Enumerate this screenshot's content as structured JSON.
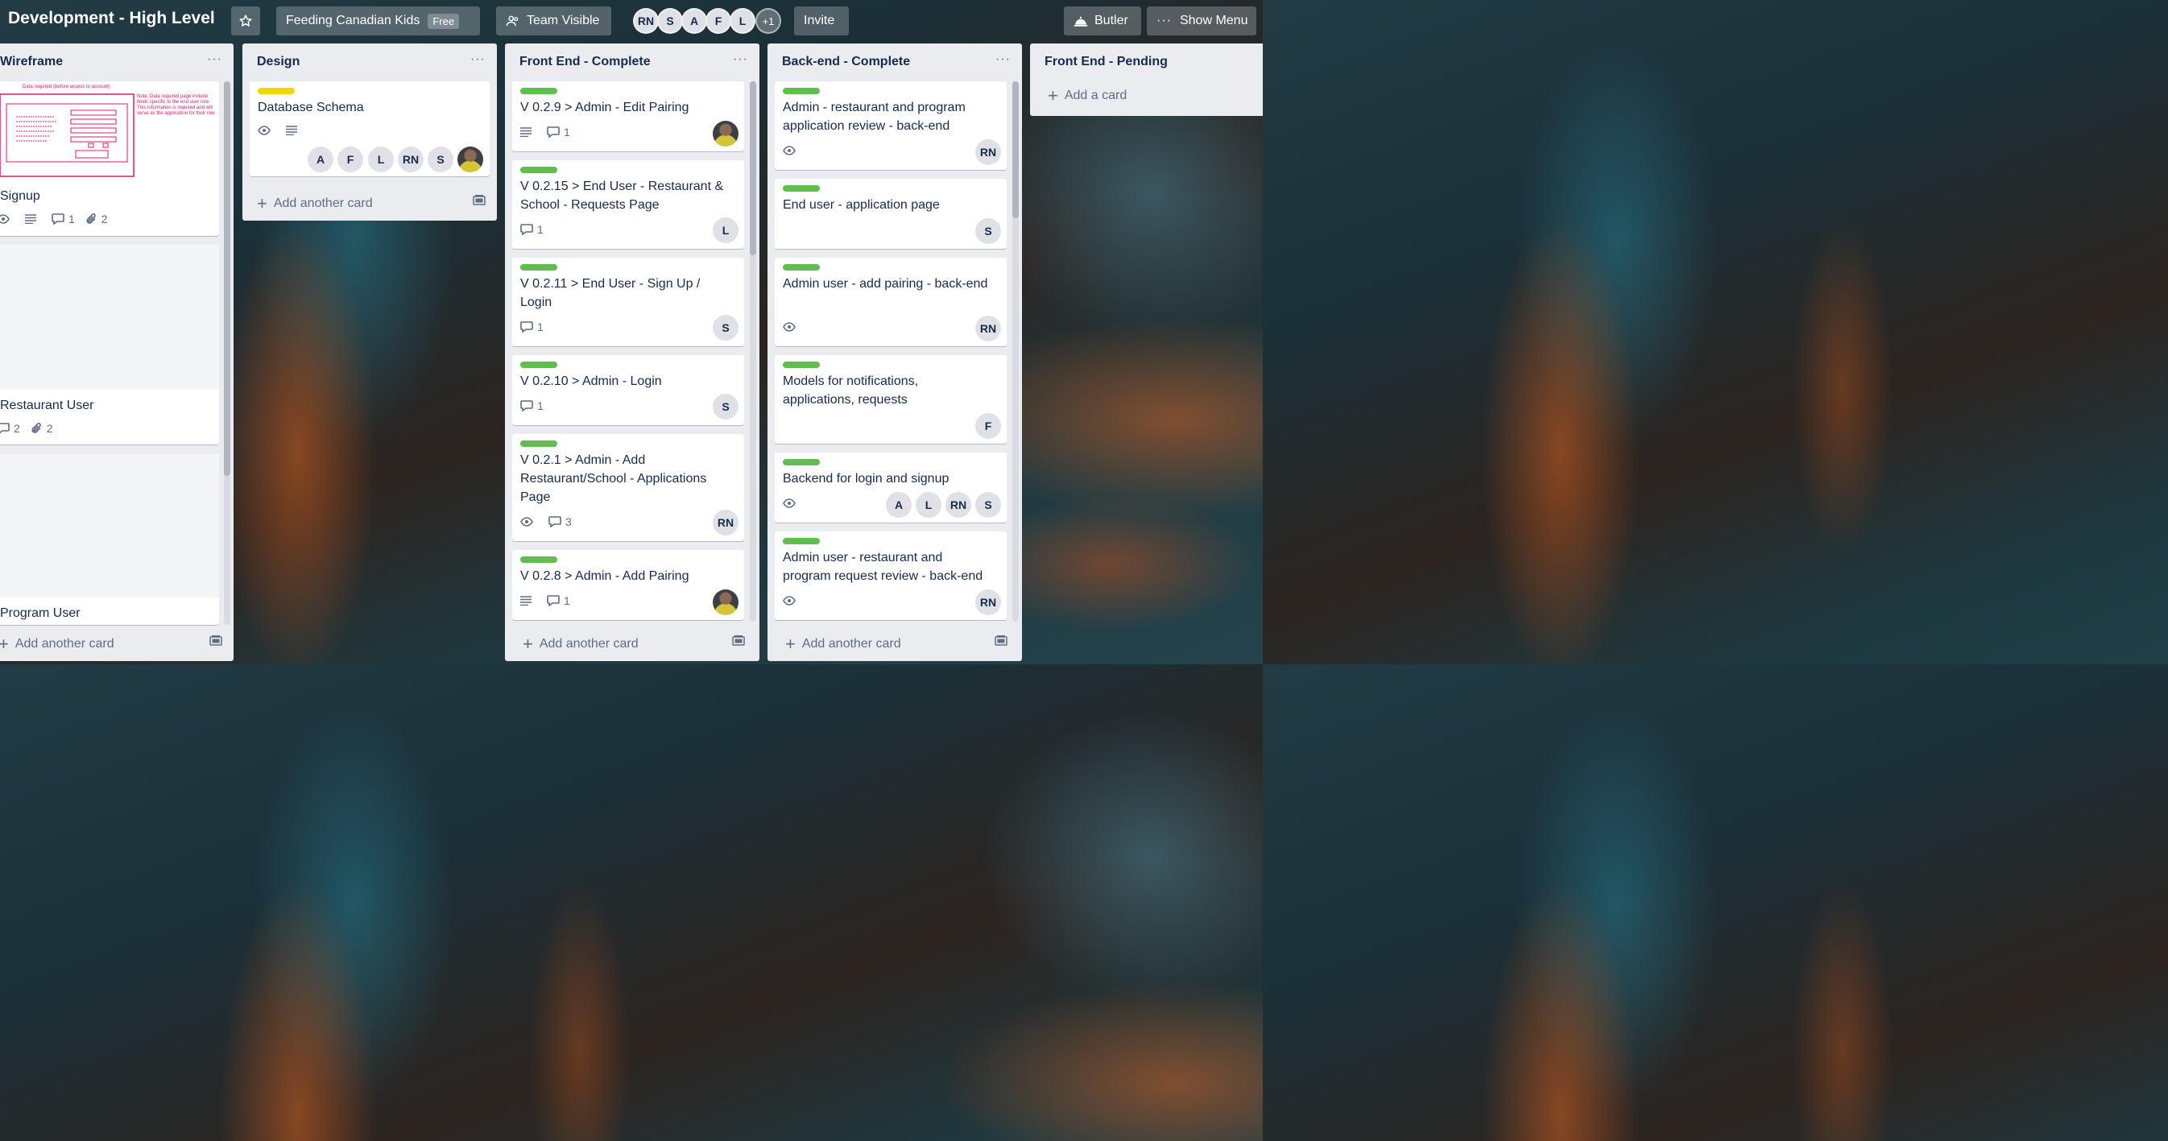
{
  "header": {
    "board_title": "Development - High Level",
    "team_name": "Feeding Canadian Kids",
    "team_plan": "Free",
    "visibility": "Team Visible",
    "members": [
      "RN",
      "S",
      "A",
      "F",
      "L"
    ],
    "members_more": "+1",
    "invite": "Invite",
    "butler": "Butler",
    "show_menu": "Show Menu"
  },
  "lists": {
    "wireframe": {
      "title": "Wireframe",
      "cards": [
        {
          "title": "Signup",
          "comments": "1",
          "attachments": "2"
        },
        {
          "title": "Restaurant User",
          "comments": "2",
          "attachments": "2"
        },
        {
          "title": "Program User"
        }
      ],
      "add": "Add another card",
      "sketch": {
        "heading": "Data required (before access to account)",
        "note": "Note: Data required page include fields specific to the end user role This information is required and will serve as the application for their role"
      }
    },
    "design": {
      "title": "Design",
      "cards": [
        {
          "title": "Database Schema",
          "members": [
            "A",
            "F",
            "L",
            "RN",
            "S"
          ]
        }
      ],
      "add": "Add another card"
    },
    "front_complete": {
      "title": "Front End - Complete",
      "cards": [
        {
          "title": "V 0.2.9 > Admin - Edit Pairing",
          "comments": "1"
        },
        {
          "title": "V 0.2.15 > End User - Restaurant & School - Requests Page",
          "comments": "1",
          "member": "L"
        },
        {
          "title": "V 0.2.11 > End User - Sign Up / Login",
          "comments": "1",
          "member": "S"
        },
        {
          "title": "V 0.2.10 > Admin - Login",
          "comments": "1",
          "member": "S"
        },
        {
          "title": "V 0.2.1 > Admin - Add Restaurant/School - Applications Page",
          "comments": "3",
          "member": "RN"
        },
        {
          "title": "V 0.2.8 > Admin - Add Pairing",
          "comments": "1"
        }
      ],
      "add": "Add another card"
    },
    "backend_complete": {
      "title": "Back-end - Complete",
      "cards": [
        {
          "title": "Admin - restaurant and program application review - back-end",
          "member": "RN"
        },
        {
          "title": "End user - application page",
          "member": "S"
        },
        {
          "title": "Admin user - add pairing - back-end",
          "member": "RN"
        },
        {
          "title": "Models for notifications, applications, requests",
          "member": "F"
        },
        {
          "title": "Backend for login and signup",
          "members": [
            "A",
            "L",
            "RN",
            "S"
          ]
        },
        {
          "title": "Admin user - restaurant and program request review - back-end",
          "member": "RN"
        }
      ],
      "add": "Add another card"
    },
    "front_pending": {
      "title": "Front End - Pending",
      "add": "Add a card"
    }
  }
}
